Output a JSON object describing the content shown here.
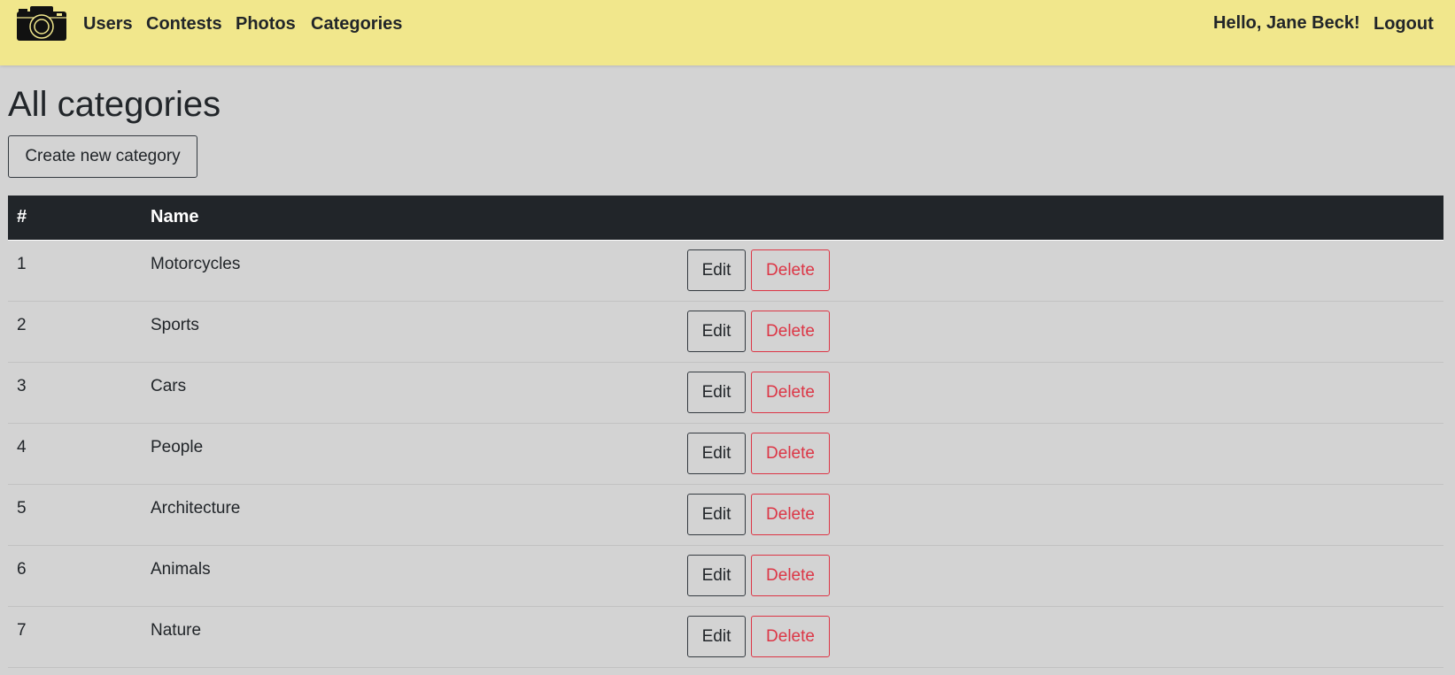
{
  "nav": {
    "logo_icon": "camera-icon",
    "links": [
      "Users",
      "Contests",
      "Photos",
      "Categories"
    ],
    "greeting": "Hello, Jane Beck!",
    "logout": "Logout"
  },
  "page": {
    "title": "All categories",
    "create_button": "Create new category"
  },
  "table": {
    "headers": [
      "#",
      "Name"
    ],
    "rows": [
      {
        "id": "1",
        "name": "Motorcycles"
      },
      {
        "id": "2",
        "name": "Sports"
      },
      {
        "id": "3",
        "name": "Cars"
      },
      {
        "id": "4",
        "name": "People"
      },
      {
        "id": "5",
        "name": "Architecture"
      },
      {
        "id": "6",
        "name": "Animals"
      },
      {
        "id": "7",
        "name": "Nature"
      }
    ],
    "edit_label": "Edit",
    "delete_label": "Delete"
  },
  "colors": {
    "navbar_bg": "#f1e78c",
    "page_bg": "#d3d3d3",
    "table_header_bg": "#212529",
    "danger": "#dc3545"
  }
}
